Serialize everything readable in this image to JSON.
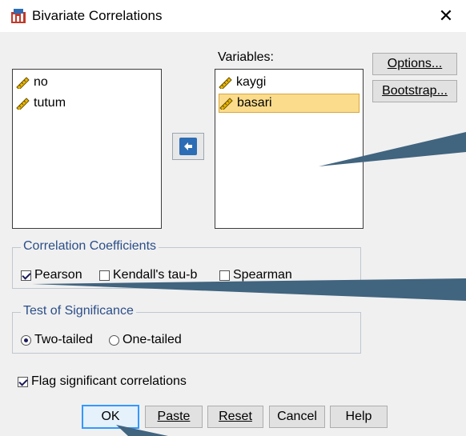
{
  "window": {
    "title": "Bivariate Correlations",
    "close_glyph": "✕"
  },
  "source_list": {
    "items": [
      {
        "label": "no",
        "icon": "scale-variable-icon"
      },
      {
        "label": "tutum",
        "icon": "scale-variable-icon"
      }
    ]
  },
  "variables": {
    "label": "Variables:",
    "items": [
      {
        "label": "kaygi",
        "selected": false
      },
      {
        "label": "basari",
        "selected": true
      }
    ]
  },
  "side_buttons": {
    "options": "Options...",
    "bootstrap": "Bootstrap..."
  },
  "correlation": {
    "legend": "Correlation Coefficients",
    "pearson": {
      "label": "Pearson",
      "checked": true
    },
    "kendall": {
      "label": "Kendall's tau-b",
      "checked": false
    },
    "spearman": {
      "label": "Spearman",
      "checked": false
    }
  },
  "significance": {
    "legend": "Test of Significance",
    "two_tailed": {
      "label": "Two-tailed",
      "selected": true
    },
    "one_tailed": {
      "label": "One-tailed",
      "selected": false
    }
  },
  "flag": {
    "label": "Flag significant correlations",
    "checked": true
  },
  "buttons": {
    "ok": "OK",
    "paste": "Paste",
    "reset": "Reset",
    "cancel": "Cancel",
    "help": "Help"
  },
  "colors": {
    "callout": "#41647f",
    "highlight": "#fadc8c",
    "accent": "#3399ff"
  }
}
